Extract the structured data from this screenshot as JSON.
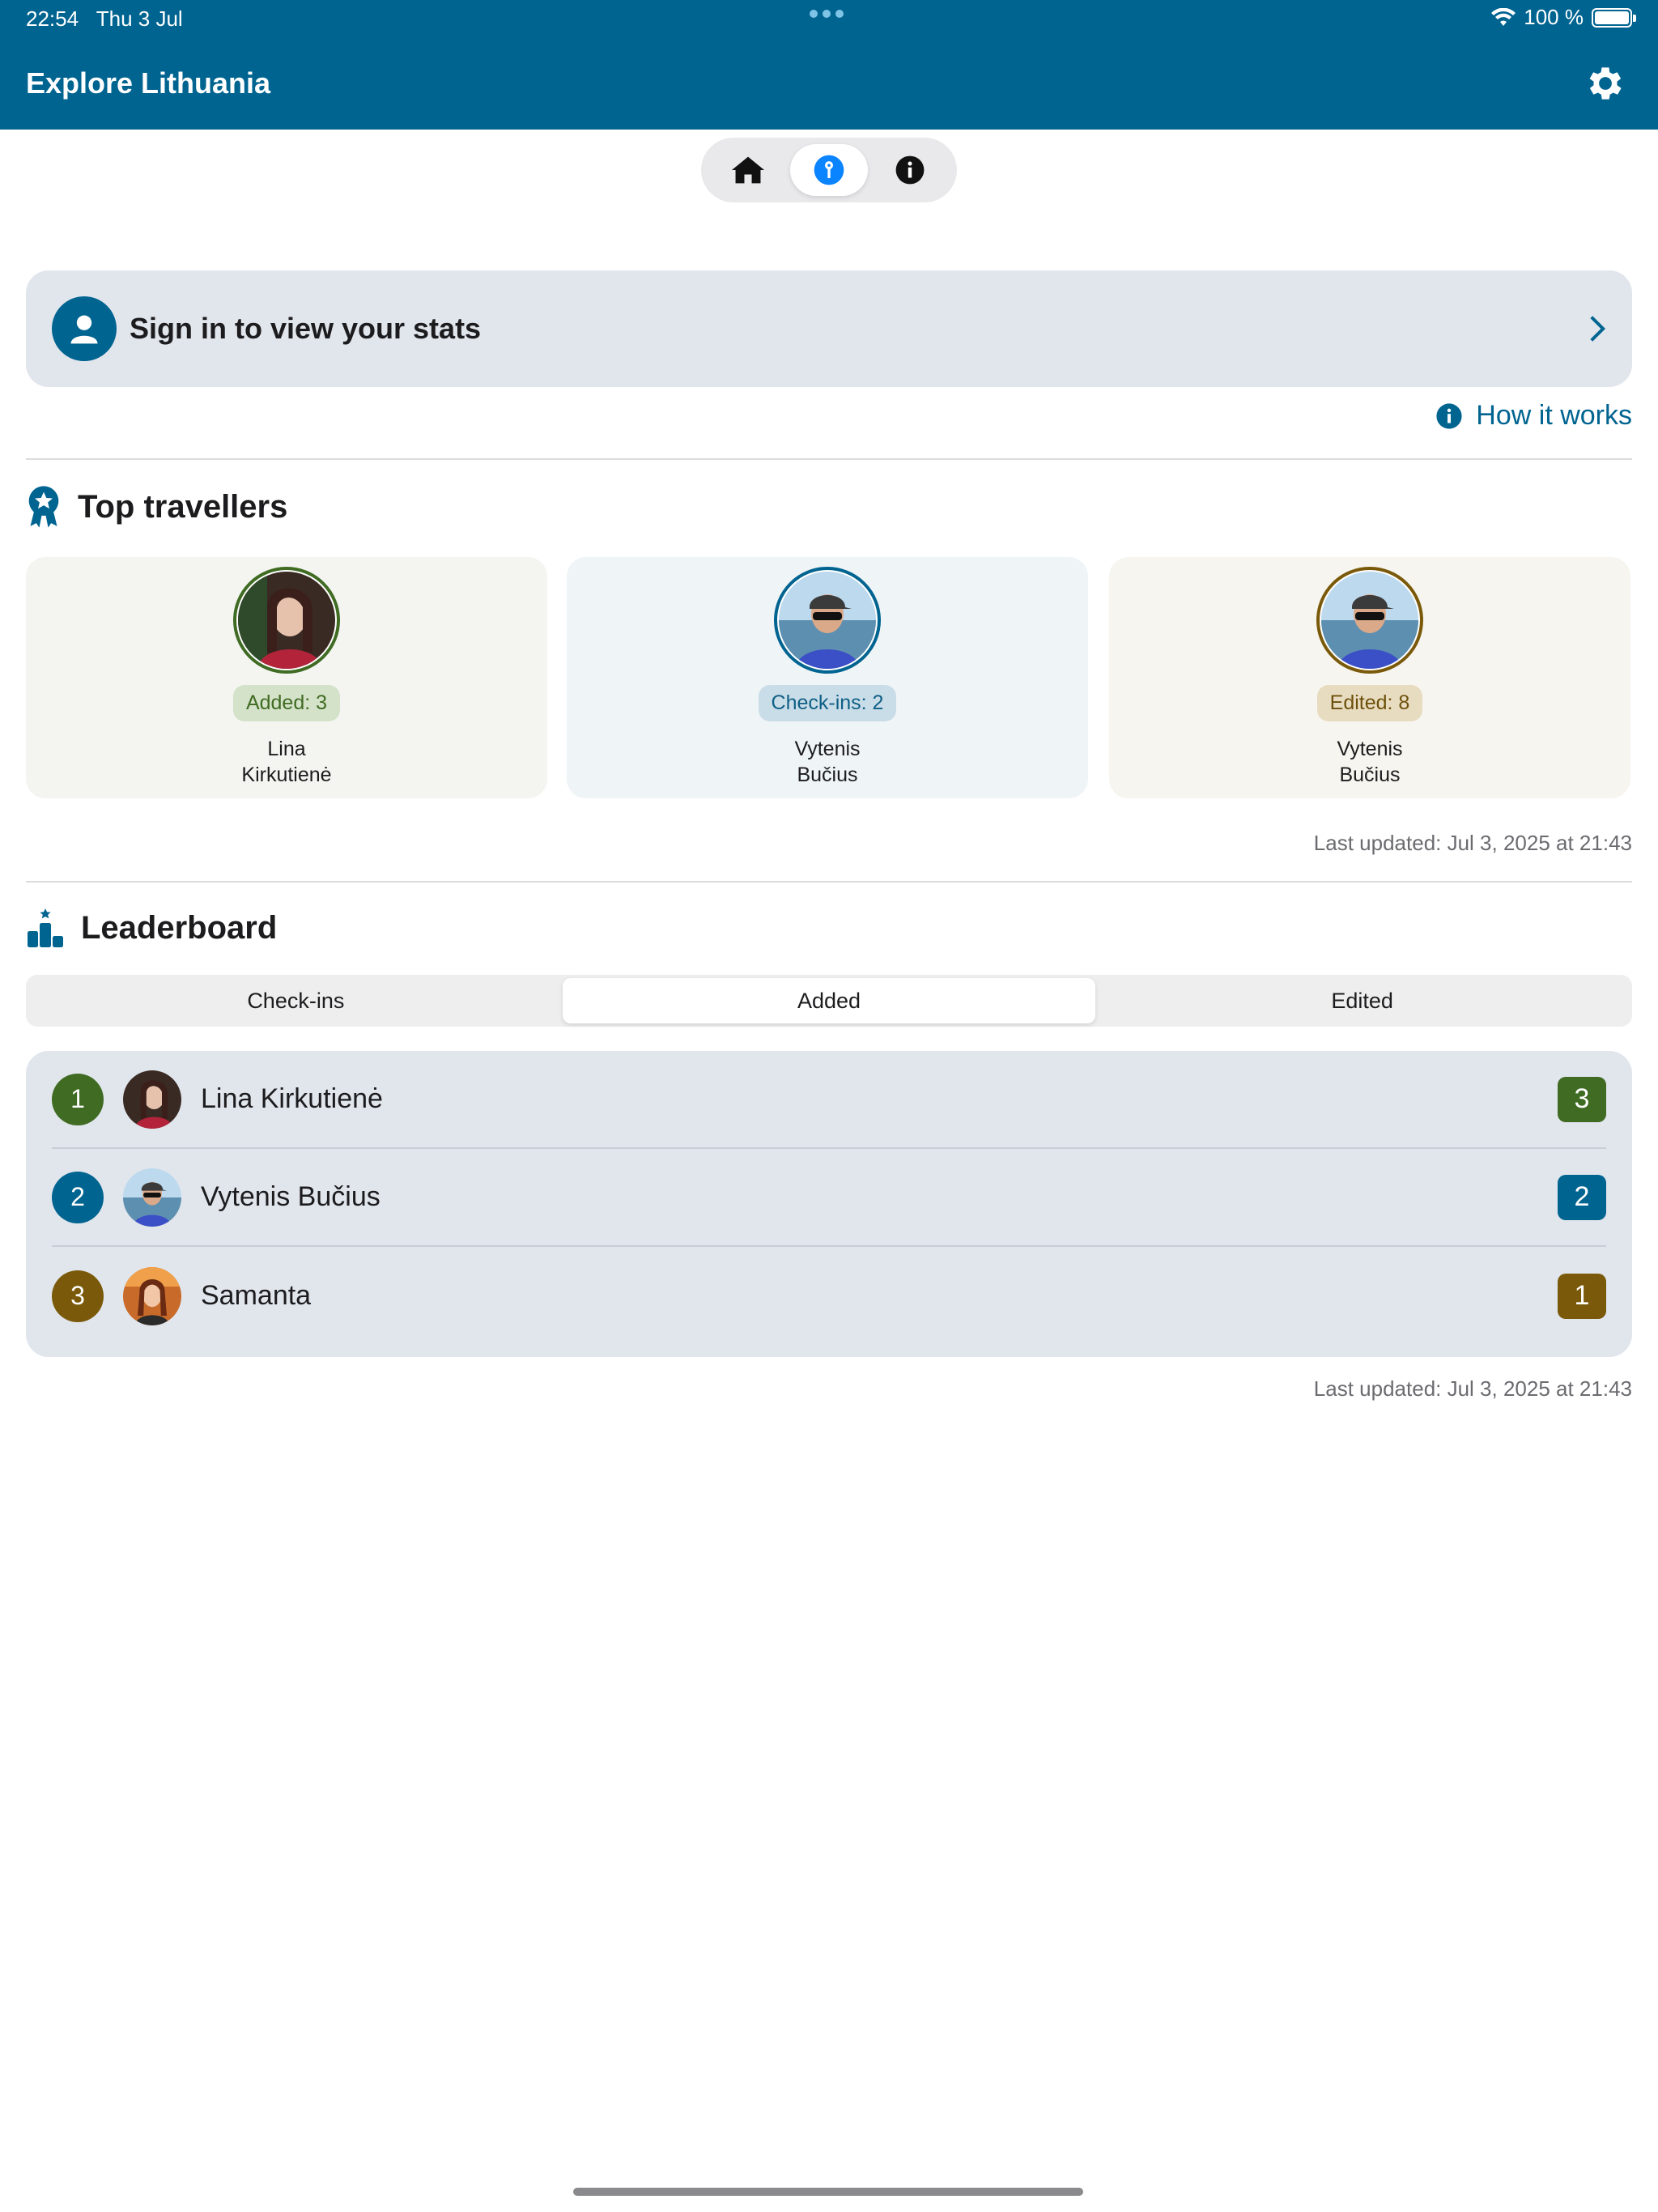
{
  "status": {
    "time": "22:54",
    "date": "Thu 3 Jul",
    "battery": "100 %"
  },
  "header": {
    "title": "Explore Lithuania"
  },
  "top_nav": [
    {
      "icon": "house-icon",
      "active": false
    },
    {
      "icon": "key-icon",
      "active": true
    },
    {
      "icon": "info-icon",
      "active": false
    }
  ],
  "signin": {
    "label": "Sign in to view your stats"
  },
  "how_it_works": "How it works",
  "top_travellers": {
    "title": "Top travellers",
    "cards": [
      {
        "badge": "Added: 3",
        "first": "Lina",
        "last": "Kirkutienė",
        "bg": "#f4f5f1",
        "ring": "#3f6b22",
        "pill_bg": "#d4e2c9",
        "pill_fg": "#3f6b22"
      },
      {
        "badge": "Check-ins: 2",
        "first": "Vytenis",
        "last": "Bučius",
        "bg": "#eff4f7",
        "ring": "#006491",
        "pill_bg": "#c9dde8",
        "pill_fg": "#0f5f86"
      },
      {
        "badge": "Edited: 8",
        "first": "Vytenis",
        "last": "Bučius",
        "bg": "#f6f5ef",
        "ring": "#7a5a0a",
        "pill_bg": "#e8dcc0",
        "pill_fg": "#6d500b"
      }
    ],
    "updated": "Last updated: Jul 3, 2025 at 21:43"
  },
  "leaderboard": {
    "title": "Leaderboard",
    "tabs": [
      "Check-ins",
      "Added",
      "Edited"
    ],
    "active_tab": "Added",
    "rows": [
      {
        "rank": "1",
        "name": "Lina Kirkutienė",
        "score": "3",
        "color": "#3f6b22"
      },
      {
        "rank": "2",
        "name": "Vytenis Bučius",
        "score": "2",
        "color": "#006491"
      },
      {
        "rank": "3",
        "name": "Samanta",
        "score": "1",
        "color": "#7a5a0a"
      }
    ],
    "updated": "Last updated: Jul 3, 2025 at 21:43"
  }
}
